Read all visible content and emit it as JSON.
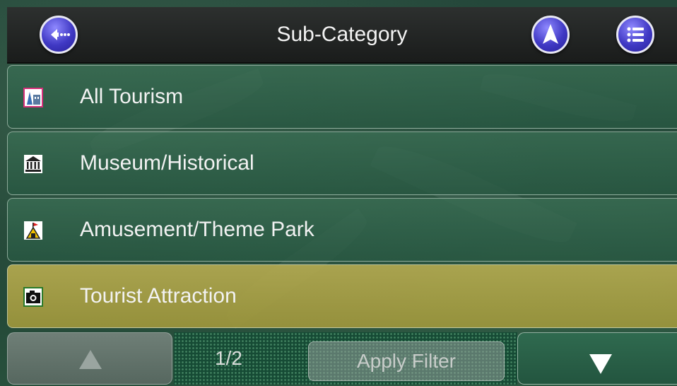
{
  "header": {
    "title": "Sub-Category",
    "back_icon": "back-arrow-icon",
    "navigate_icon": "navigation-arrow-icon",
    "menu_icon": "list-menu-icon"
  },
  "list": {
    "items": [
      {
        "label": "All Tourism",
        "icon": "tourism-icon",
        "selected": false
      },
      {
        "label": "Museum/Historical",
        "icon": "museum-icon",
        "selected": false
      },
      {
        "label": "Amusement/Theme Park",
        "icon": "amusement-park-icon",
        "selected": false
      },
      {
        "label": "Tourist Attraction",
        "icon": "camera-icon",
        "selected": true
      }
    ]
  },
  "footer": {
    "page_indicator": "1/2",
    "apply_filter_label": "Apply Filter",
    "up_icon": "arrow-up-icon",
    "down_icon": "arrow-down-icon"
  },
  "colors": {
    "selected_row": "#a89e44",
    "row": "#2f6a4f",
    "header": "#1f2120",
    "accent_button": "#4039c4"
  }
}
